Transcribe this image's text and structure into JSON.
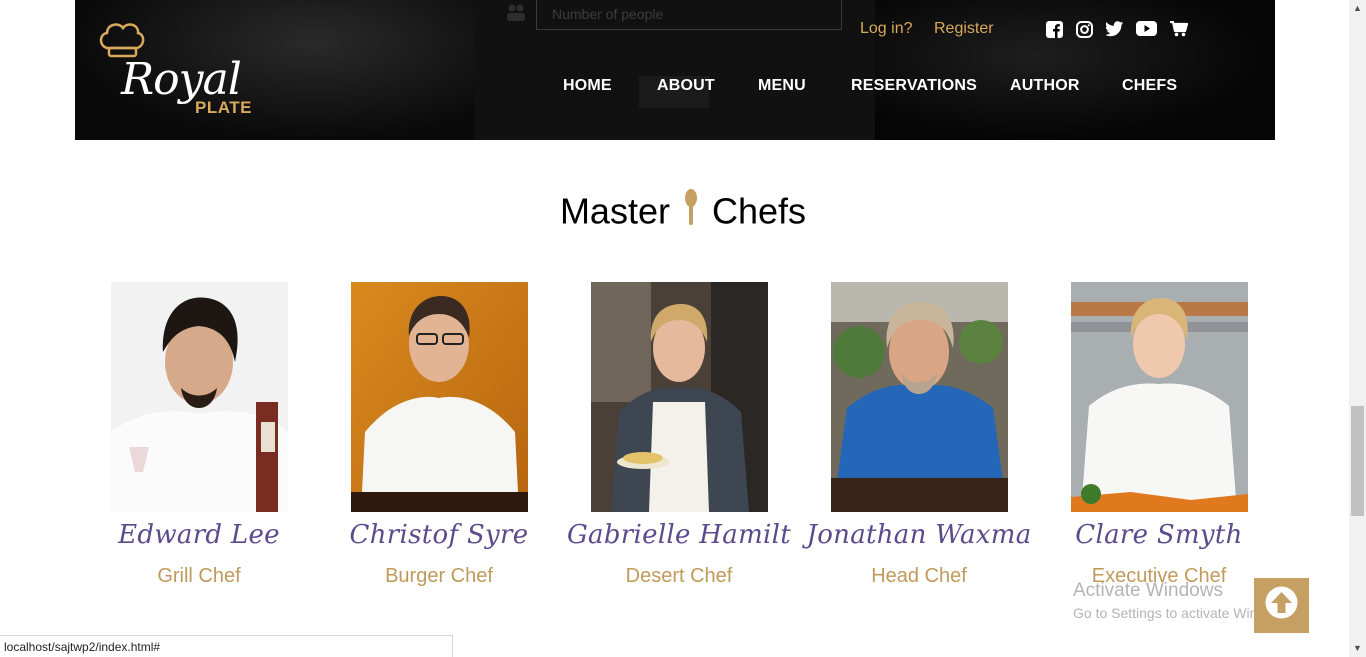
{
  "header": {
    "logo": {
      "word": "Royal",
      "sub": "PLATE"
    },
    "auth": {
      "login": "Log in?",
      "register": "Register"
    },
    "social_icons": [
      "facebook-icon",
      "instagram-icon",
      "twitter-icon",
      "youtube-icon",
      "cart-icon"
    ],
    "nav": [
      "HOME",
      "ABOUT",
      "MENU",
      "RESERVATIONS",
      "AUTHOR",
      "CHEFS"
    ],
    "background_form": {
      "placeholder": "Number of people"
    }
  },
  "section": {
    "title_left": "Master",
    "title_right": "Chefs"
  },
  "chefs": [
    {
      "name": "Edward Lee",
      "role": "Grill Chef"
    },
    {
      "name": "Christof Syre",
      "role": "Burger Chef"
    },
    {
      "name": "Gabrielle Hamilt",
      "role": "Desert Chef"
    },
    {
      "name": "Jonathan Waxma",
      "role": "Head Chef"
    },
    {
      "name": "Clare Smyth",
      "role": "Executive Chef"
    }
  ],
  "watermark": {
    "title": "Activate Windows",
    "subtitle": "Go to Settings to activate Windows."
  },
  "status_bar": {
    "url": "localhost/sajtwp2/index.html#"
  },
  "colors": {
    "accent": "#c6a062",
    "nav_text": "#ffffff",
    "chef_name": "#5b4a8c",
    "chef_role": "#c09a5b"
  }
}
